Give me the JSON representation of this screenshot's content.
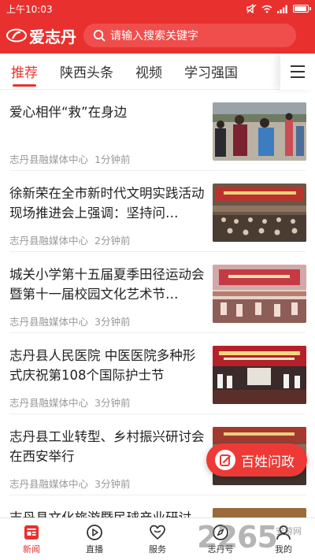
{
  "status_bar": {
    "time": "上午10:03"
  },
  "header": {
    "logo_text": "爱志丹",
    "search_placeholder": "请输入搜索关键字",
    "brand_color": "#e8312f"
  },
  "tabs": [
    {
      "label": "推荐",
      "active": true
    },
    {
      "label": "陕西头条",
      "active": false
    },
    {
      "label": "视频",
      "active": false
    },
    {
      "label": "学习强国",
      "active": false
    }
  ],
  "news": [
    {
      "title": "爱心相伴“救”在身边",
      "source": "志丹县融媒体中心",
      "time": "1分钟前"
    },
    {
      "title": "徐新荣在全市新时代文明实践活动现场推进会上强调：坚持问…",
      "source": "志丹县融媒体中心",
      "time": "2分钟前"
    },
    {
      "title": "城关小学第十五届夏季田径运动会暨第十一届校园文化艺术节…",
      "source": "志丹县融媒体中心",
      "time": "3分钟前"
    },
    {
      "title": "志丹县人民医院 中医医院多种形式庆祝第108个国际护士节",
      "source": "志丹县融媒体中心",
      "time": "3分钟前"
    },
    {
      "title": "志丹县工业转型、乡村振兴研讨会在西安举行",
      "source": "志丹县融媒体中心",
      "time": "3分钟前"
    },
    {
      "title": "志丹县文化旅游暨民球产业研讨",
      "source": "",
      "time": ""
    }
  ],
  "fab": {
    "label": "百姓问政"
  },
  "bottom_nav": [
    {
      "label": "新闻",
      "icon": "news-icon",
      "active": true
    },
    {
      "label": "直播",
      "icon": "play-icon",
      "active": false
    },
    {
      "label": "服务",
      "icon": "heart-icon",
      "active": false
    },
    {
      "label": "志丹号",
      "icon": "compass-icon",
      "active": false
    },
    {
      "label": "我的",
      "icon": "user-icon",
      "active": false
    }
  ],
  "watermark": {
    "number": "2265",
    "site": "安游网"
  }
}
